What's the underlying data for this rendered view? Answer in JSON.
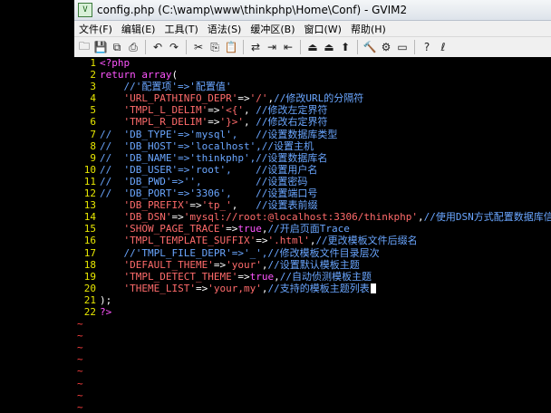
{
  "window": {
    "title": "config.php (C:\\wamp\\www\\thinkphp\\Home\\Conf) - GVIM2",
    "app_icon": "vim-icon"
  },
  "menu": [
    "文件(F)",
    "编辑(E)",
    "工具(T)",
    "语法(S)",
    "缓冲区(B)",
    "窗口(W)",
    "帮助(H)"
  ],
  "toolbar": [
    {
      "name": "open-icon",
      "glyph": "🗀"
    },
    {
      "name": "save-icon",
      "glyph": "💾"
    },
    {
      "name": "save-all-icon",
      "glyph": "⧉"
    },
    {
      "name": "print-icon",
      "glyph": "⎙"
    },
    {
      "sep": true
    },
    {
      "name": "undo-icon",
      "glyph": "↶"
    },
    {
      "name": "redo-icon",
      "glyph": "↷"
    },
    {
      "sep": true
    },
    {
      "name": "cut-icon",
      "glyph": "✂"
    },
    {
      "name": "copy-icon",
      "glyph": "⎘"
    },
    {
      "name": "paste-icon",
      "glyph": "📋"
    },
    {
      "sep": true
    },
    {
      "name": "replace-icon",
      "glyph": "⇄"
    },
    {
      "name": "find-next-icon",
      "glyph": "⇥"
    },
    {
      "name": "find-prev-icon",
      "glyph": "⇤"
    },
    {
      "sep": true
    },
    {
      "name": "load-session-icon",
      "glyph": "⏏"
    },
    {
      "name": "save-session-icon",
      "glyph": "⏏"
    },
    {
      "name": "run-script-icon",
      "glyph": "⬆"
    },
    {
      "sep": true
    },
    {
      "name": "make-icon",
      "glyph": "🔨"
    },
    {
      "name": "shell-icon",
      "glyph": "⚙"
    },
    {
      "name": "tags-icon",
      "glyph": "▭"
    },
    {
      "sep": true
    },
    {
      "name": "help-icon",
      "glyph": "?"
    },
    {
      "name": "find-help-icon",
      "glyph": "ℓ"
    }
  ],
  "colors": {
    "line_number": "#e8e800",
    "keyword": "#ff55ff",
    "string": "#ff6b6b",
    "comment": "#6aa6ff",
    "tilde": "#ff4040"
  },
  "lines": [
    {
      "n": "1",
      "segs": [
        [
          "kw",
          "<?php"
        ]
      ]
    },
    {
      "n": "2",
      "segs": [
        [
          "kw",
          "return array"
        ],
        [
          "op",
          "("
        ]
      ]
    },
    {
      "n": "3",
      "segs": [
        [
          "cm",
          "    //'配置项'=>'配置值'"
        ]
      ]
    },
    {
      "n": "4",
      "segs": [
        [
          "pl",
          "    "
        ],
        [
          "str",
          "'URL_PATHINFO_DEPR'"
        ],
        [
          "op",
          "=>"
        ],
        [
          "str",
          "'/'"
        ],
        [
          "op",
          ","
        ],
        [
          "cm",
          "//修改URL的分隔符"
        ]
      ]
    },
    {
      "n": "5",
      "segs": [
        [
          "pl",
          "    "
        ],
        [
          "str",
          "'TMPL_L_DELIM'"
        ],
        [
          "op",
          "=>"
        ],
        [
          "str",
          "'<{'"
        ],
        [
          "op",
          ", "
        ],
        [
          "cm",
          "//修改左定界符"
        ]
      ]
    },
    {
      "n": "6",
      "segs": [
        [
          "pl",
          "    "
        ],
        [
          "str",
          "'TMPL_R_DELIM'"
        ],
        [
          "op",
          "=>"
        ],
        [
          "str",
          "'}>'"
        ],
        [
          "op",
          ", "
        ],
        [
          "cm",
          "//修改右定界符"
        ]
      ]
    },
    {
      "n": "7",
      "segs": [
        [
          "cm",
          "//  'DB_TYPE'=>'mysql',   //设置数据库类型"
        ]
      ]
    },
    {
      "n": "8",
      "segs": [
        [
          "cm",
          "//  'DB_HOST'=>'localhost',//设置主机"
        ]
      ]
    },
    {
      "n": "9",
      "segs": [
        [
          "cm",
          "//  'DB_NAME'=>'thinkphp',//设置数据库名"
        ]
      ]
    },
    {
      "n": "10",
      "segs": [
        [
          "cm",
          "//  'DB_USER'=>'root',    //设置用户名"
        ]
      ]
    },
    {
      "n": "11",
      "segs": [
        [
          "cm",
          "//  'DB_PWD'=>'',         //设置密码"
        ]
      ]
    },
    {
      "n": "12",
      "segs": [
        [
          "cm",
          "//  'DB_PORT'=>'3306',    //设置端口号"
        ]
      ]
    },
    {
      "n": "13",
      "segs": [
        [
          "pl",
          "    "
        ],
        [
          "str",
          "'DB_PREFIX'"
        ],
        [
          "op",
          "=>"
        ],
        [
          "str",
          "'tp_'"
        ],
        [
          "op",
          ",   "
        ],
        [
          "cm",
          "//设置表前缀"
        ]
      ]
    },
    {
      "n": "14",
      "segs": [
        [
          "pl",
          "    "
        ],
        [
          "str",
          "'DB_DSN'"
        ],
        [
          "op",
          "=>"
        ],
        [
          "str",
          "'mysql://root:@localhost:3306/thinkphp'"
        ],
        [
          "op",
          ","
        ],
        [
          "cm",
          "//使用DSN方式配置数据库信息"
        ]
      ]
    },
    {
      "n": "15",
      "segs": [
        [
          "pl",
          "    "
        ],
        [
          "str",
          "'SHOW_PAGE_TRACE'"
        ],
        [
          "op",
          "=>"
        ],
        [
          "kw",
          "true"
        ],
        [
          "op",
          ","
        ],
        [
          "cm",
          "//开启页面Trace"
        ]
      ]
    },
    {
      "n": "16",
      "segs": [
        [
          "pl",
          "    "
        ],
        [
          "str",
          "'TMPL_TEMPLATE_SUFFIX'"
        ],
        [
          "op",
          "=>"
        ],
        [
          "str",
          "'.html'"
        ],
        [
          "op",
          ","
        ],
        [
          "cm",
          "//更改模板文件后缀名"
        ]
      ]
    },
    {
      "n": "17",
      "segs": [
        [
          "cm",
          "    //'TMPL_FILE_DEPR'=>'_',//修改模板文件目录层次"
        ]
      ]
    },
    {
      "n": "18",
      "segs": [
        [
          "pl",
          "    "
        ],
        [
          "str",
          "'DEFAULT_THEME'"
        ],
        [
          "op",
          "=>"
        ],
        [
          "str",
          "'your'"
        ],
        [
          "op",
          ","
        ],
        [
          "cm",
          "//设置默认模板主题"
        ]
      ]
    },
    {
      "n": "19",
      "segs": [
        [
          "pl",
          "    "
        ],
        [
          "str",
          "'TMPL_DETECT_THEME'"
        ],
        [
          "op",
          "=>"
        ],
        [
          "kw",
          "true"
        ],
        [
          "op",
          ","
        ],
        [
          "cm",
          "//自动侦测模板主题"
        ]
      ]
    },
    {
      "n": "20",
      "segs": [
        [
          "pl",
          "    "
        ],
        [
          "str",
          "'THEME_LIST'"
        ],
        [
          "op",
          "=>"
        ],
        [
          "str",
          "'your,my'"
        ],
        [
          "op",
          ","
        ],
        [
          "cm",
          "//支持的模板主题列表"
        ]
      ],
      "cursor": true
    },
    {
      "n": "21",
      "segs": [
        [
          "op",
          ");"
        ]
      ]
    },
    {
      "n": "22",
      "segs": [
        [
          "kw",
          "?>"
        ]
      ]
    }
  ],
  "tilde_count": 8,
  "tilde_char": "~"
}
